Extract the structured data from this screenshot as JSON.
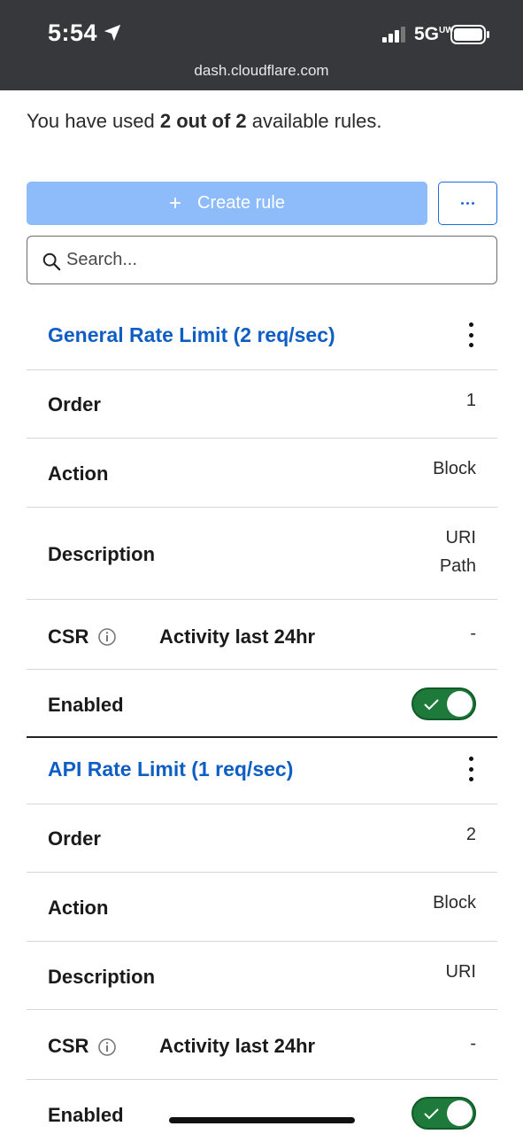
{
  "status_bar": {
    "time": "5:54",
    "network": "5G",
    "network_sub": "UW",
    "url": "dash.cloudflare.com"
  },
  "usage": {
    "prefix": "You have used ",
    "count": "2 out of 2",
    "suffix": " available rules."
  },
  "toolbar": {
    "create_plus": "+",
    "create_label": "Create rule",
    "more_label": "..."
  },
  "search": {
    "placeholder": "Search..."
  },
  "labels": {
    "order": "Order",
    "action": "Action",
    "description": "Description",
    "csr": "CSR",
    "activity": "Activity last 24hr",
    "enabled": "Enabled"
  },
  "rules": [
    {
      "title": "General Rate Limit (2 req/sec)",
      "order": "1",
      "action": "Block",
      "description_line1": "URI",
      "description_line2": "Path",
      "activity": "-",
      "enabled": true
    },
    {
      "title": "API Rate Limit (1 req/sec)",
      "order": "2",
      "action": "Block",
      "description_line1": "URI",
      "activity": "-",
      "enabled": true
    }
  ],
  "colors": {
    "accent": "#0f5ec4",
    "create_button": "#8ebcfb",
    "toggle_on": "#1e7a3a",
    "status_bar": "#37383b"
  }
}
